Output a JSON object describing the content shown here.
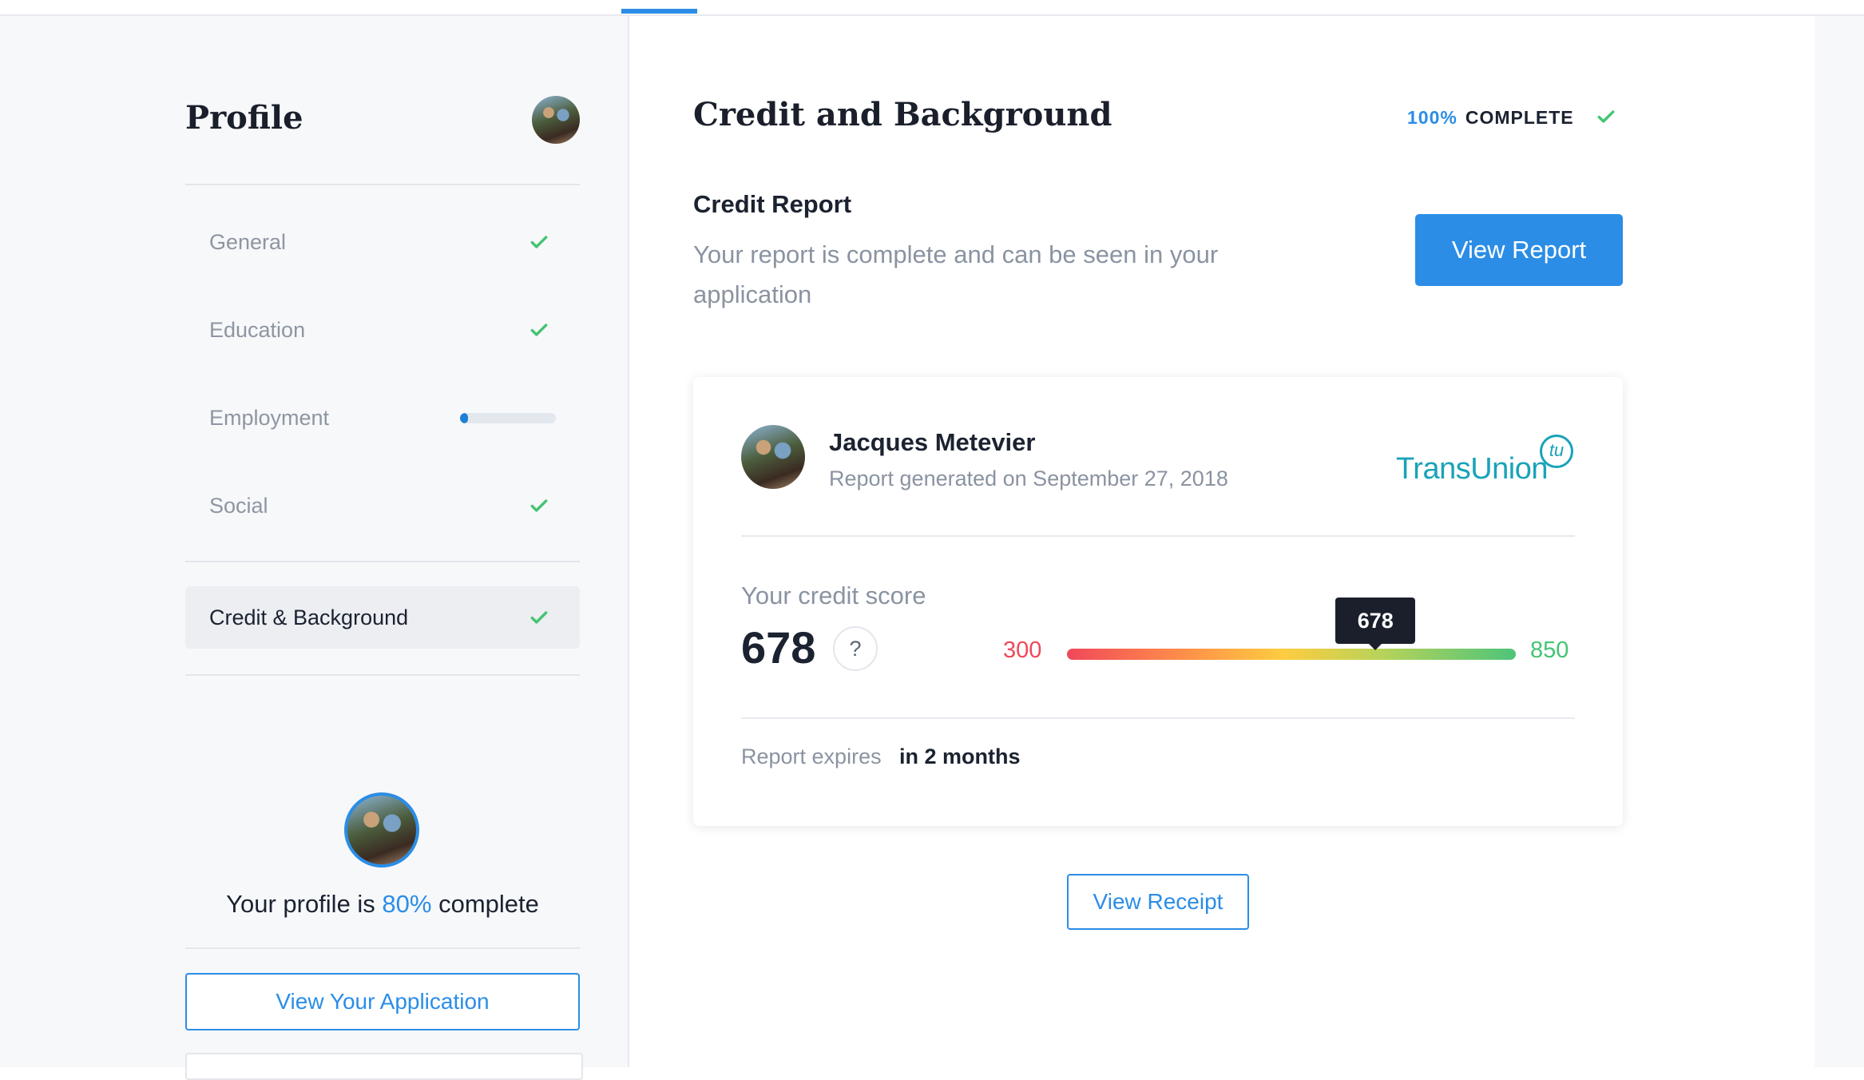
{
  "colors": {
    "accent": "#2b8de6",
    "success": "#43c472",
    "score_low": "#f0485a",
    "score_high": "#43c472",
    "dark": "#1a1f2b"
  },
  "sidebar": {
    "title": "Profile",
    "items": [
      {
        "label": "General",
        "status": "complete",
        "icon": "check-icon"
      },
      {
        "label": "Education",
        "status": "complete",
        "icon": "check-icon"
      },
      {
        "label": "Employment",
        "status": "in-progress",
        "progress": 0.08
      },
      {
        "label": "Social",
        "status": "complete",
        "icon": "check-icon"
      },
      {
        "label": "Credit & Background",
        "status": "complete",
        "icon": "check-icon",
        "active": true
      }
    ],
    "completion": {
      "prefix": "Your profile is ",
      "percent": "80%",
      "suffix": " complete"
    },
    "view_application_label": "View Your Application"
  },
  "main": {
    "title": "Credit and Background",
    "completion_percent": "100%",
    "completion_label": "COMPLETE",
    "credit_report": {
      "heading": "Credit Report",
      "description": "Your report is complete and can be seen in your application",
      "view_report_label": "View Report"
    },
    "card": {
      "name": "Jacques Metevier",
      "generated": "Report generated on September 27, 2018",
      "bureau": "TransUnion",
      "bureau_mark": "tu",
      "score_label": "Your credit score",
      "score": 678,
      "score_display": "678",
      "score_help": "?",
      "score_min": 300,
      "score_min_display": "300",
      "score_max": 850,
      "score_max_display": "850",
      "expires_label": "Report expires",
      "expires_value": "in 2 months"
    },
    "view_receipt_label": "View Receipt"
  }
}
